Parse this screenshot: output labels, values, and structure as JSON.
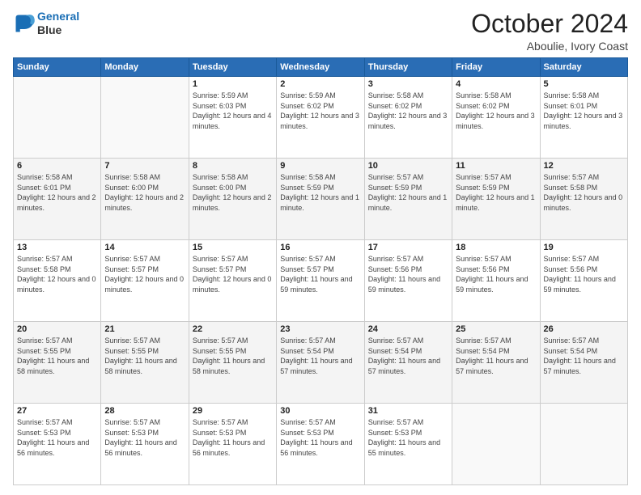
{
  "header": {
    "logo_line1": "General",
    "logo_line2": "Blue",
    "month": "October 2024",
    "location": "Aboulie, Ivory Coast"
  },
  "weekdays": [
    "Sunday",
    "Monday",
    "Tuesday",
    "Wednesday",
    "Thursday",
    "Friday",
    "Saturday"
  ],
  "weeks": [
    [
      {
        "day": "",
        "info": ""
      },
      {
        "day": "",
        "info": ""
      },
      {
        "day": "1",
        "info": "Sunrise: 5:59 AM\nSunset: 6:03 PM\nDaylight: 12 hours and 4 minutes."
      },
      {
        "day": "2",
        "info": "Sunrise: 5:59 AM\nSunset: 6:02 PM\nDaylight: 12 hours and 3 minutes."
      },
      {
        "day": "3",
        "info": "Sunrise: 5:58 AM\nSunset: 6:02 PM\nDaylight: 12 hours and 3 minutes."
      },
      {
        "day": "4",
        "info": "Sunrise: 5:58 AM\nSunset: 6:02 PM\nDaylight: 12 hours and 3 minutes."
      },
      {
        "day": "5",
        "info": "Sunrise: 5:58 AM\nSunset: 6:01 PM\nDaylight: 12 hours and 3 minutes."
      }
    ],
    [
      {
        "day": "6",
        "info": "Sunrise: 5:58 AM\nSunset: 6:01 PM\nDaylight: 12 hours and 2 minutes."
      },
      {
        "day": "7",
        "info": "Sunrise: 5:58 AM\nSunset: 6:00 PM\nDaylight: 12 hours and 2 minutes."
      },
      {
        "day": "8",
        "info": "Sunrise: 5:58 AM\nSunset: 6:00 PM\nDaylight: 12 hours and 2 minutes."
      },
      {
        "day": "9",
        "info": "Sunrise: 5:58 AM\nSunset: 5:59 PM\nDaylight: 12 hours and 1 minute."
      },
      {
        "day": "10",
        "info": "Sunrise: 5:57 AM\nSunset: 5:59 PM\nDaylight: 12 hours and 1 minute."
      },
      {
        "day": "11",
        "info": "Sunrise: 5:57 AM\nSunset: 5:59 PM\nDaylight: 12 hours and 1 minute."
      },
      {
        "day": "12",
        "info": "Sunrise: 5:57 AM\nSunset: 5:58 PM\nDaylight: 12 hours and 0 minutes."
      }
    ],
    [
      {
        "day": "13",
        "info": "Sunrise: 5:57 AM\nSunset: 5:58 PM\nDaylight: 12 hours and 0 minutes."
      },
      {
        "day": "14",
        "info": "Sunrise: 5:57 AM\nSunset: 5:57 PM\nDaylight: 12 hours and 0 minutes."
      },
      {
        "day": "15",
        "info": "Sunrise: 5:57 AM\nSunset: 5:57 PM\nDaylight: 12 hours and 0 minutes."
      },
      {
        "day": "16",
        "info": "Sunrise: 5:57 AM\nSunset: 5:57 PM\nDaylight: 11 hours and 59 minutes."
      },
      {
        "day": "17",
        "info": "Sunrise: 5:57 AM\nSunset: 5:56 PM\nDaylight: 11 hours and 59 minutes."
      },
      {
        "day": "18",
        "info": "Sunrise: 5:57 AM\nSunset: 5:56 PM\nDaylight: 11 hours and 59 minutes."
      },
      {
        "day": "19",
        "info": "Sunrise: 5:57 AM\nSunset: 5:56 PM\nDaylight: 11 hours and 59 minutes."
      }
    ],
    [
      {
        "day": "20",
        "info": "Sunrise: 5:57 AM\nSunset: 5:55 PM\nDaylight: 11 hours and 58 minutes."
      },
      {
        "day": "21",
        "info": "Sunrise: 5:57 AM\nSunset: 5:55 PM\nDaylight: 11 hours and 58 minutes."
      },
      {
        "day": "22",
        "info": "Sunrise: 5:57 AM\nSunset: 5:55 PM\nDaylight: 11 hours and 58 minutes."
      },
      {
        "day": "23",
        "info": "Sunrise: 5:57 AM\nSunset: 5:54 PM\nDaylight: 11 hours and 57 minutes."
      },
      {
        "day": "24",
        "info": "Sunrise: 5:57 AM\nSunset: 5:54 PM\nDaylight: 11 hours and 57 minutes."
      },
      {
        "day": "25",
        "info": "Sunrise: 5:57 AM\nSunset: 5:54 PM\nDaylight: 11 hours and 57 minutes."
      },
      {
        "day": "26",
        "info": "Sunrise: 5:57 AM\nSunset: 5:54 PM\nDaylight: 11 hours and 57 minutes."
      }
    ],
    [
      {
        "day": "27",
        "info": "Sunrise: 5:57 AM\nSunset: 5:53 PM\nDaylight: 11 hours and 56 minutes."
      },
      {
        "day": "28",
        "info": "Sunrise: 5:57 AM\nSunset: 5:53 PM\nDaylight: 11 hours and 56 minutes."
      },
      {
        "day": "29",
        "info": "Sunrise: 5:57 AM\nSunset: 5:53 PM\nDaylight: 11 hours and 56 minutes."
      },
      {
        "day": "30",
        "info": "Sunrise: 5:57 AM\nSunset: 5:53 PM\nDaylight: 11 hours and 56 minutes."
      },
      {
        "day": "31",
        "info": "Sunrise: 5:57 AM\nSunset: 5:53 PM\nDaylight: 11 hours and 55 minutes."
      },
      {
        "day": "",
        "info": ""
      },
      {
        "day": "",
        "info": ""
      }
    ]
  ]
}
